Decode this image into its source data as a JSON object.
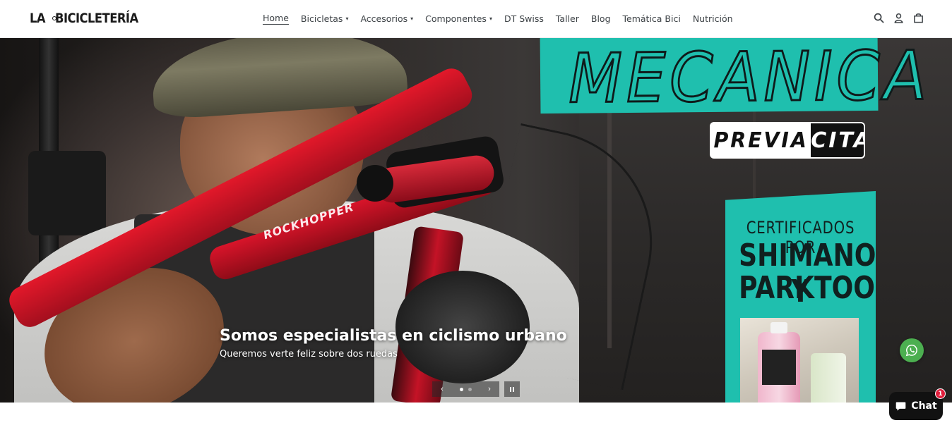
{
  "brand": {
    "logo_left": "LA",
    "logo_right": "BICICLETERÍA"
  },
  "nav": {
    "items": [
      {
        "label": "Home",
        "caret": "",
        "active": true
      },
      {
        "label": "Bicicletas",
        "caret": "⌄"
      },
      {
        "label": "Accesorios",
        "caret": "⌄"
      },
      {
        "label": "Componentes",
        "caret": "⌄"
      },
      {
        "label": "DT Swiss",
        "caret": ""
      },
      {
        "label": "Taller",
        "caret": ""
      },
      {
        "label": "Blog",
        "caret": ""
      },
      {
        "label": "Temática Bici",
        "caret": ""
      },
      {
        "label": "Nutrición",
        "caret": ""
      }
    ]
  },
  "header_icons": [
    "search-icon",
    "account-icon",
    "cart-icon"
  ],
  "hero": {
    "poster_top": "MECANICA",
    "badge_left": "PREVIA",
    "badge_right": "CITA",
    "poster_line1": "CERTIFICADOS POR",
    "poster_line2": "SHIMANO Y",
    "poster_line3": "PARKTOOL",
    "frame_decal": "ROCKHOPPER",
    "title": "Somos especialistas en ciclismo urbano",
    "subtitle": "Queremos verte feliz sobre dos ruedas",
    "slides_total": 2,
    "slide_active": 1,
    "prev_arrow": "‹",
    "next_arrow": "›"
  },
  "chat": {
    "label": "Chat",
    "badge_count": "1"
  },
  "colors": {
    "teal": "#1fbfae",
    "whatsapp": "#4caf50",
    "badge": "#e01e3c"
  }
}
